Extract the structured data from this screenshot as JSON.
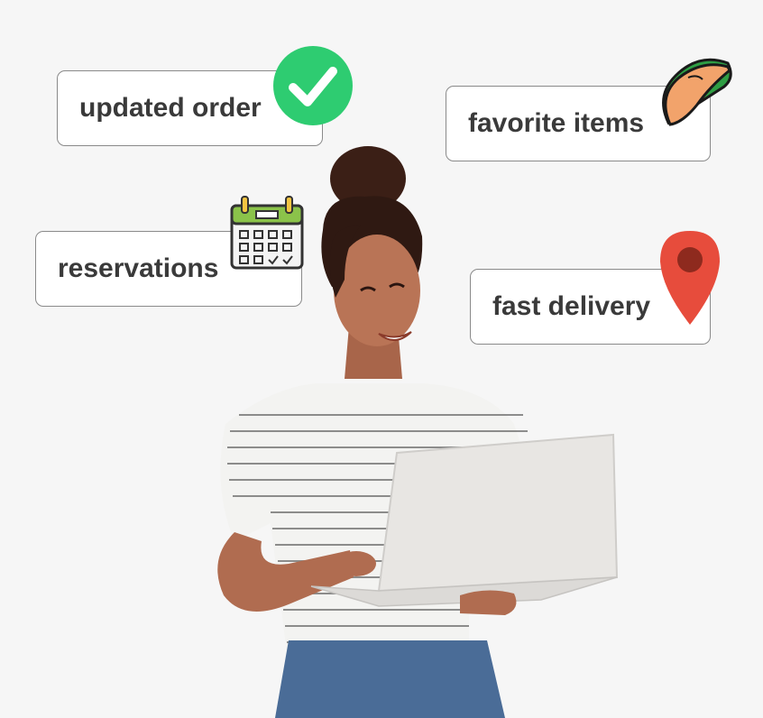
{
  "features": {
    "updated_order": {
      "label": "updated order",
      "icon": "checkmark-circle-icon",
      "color": "#2ecc71"
    },
    "favorite_items": {
      "label": "favorite items",
      "icon": "taco-icon",
      "color": "#f2a36b"
    },
    "reservations": {
      "label": "reservations",
      "icon": "calendar-icon",
      "color": "#8bc34a"
    },
    "fast_delivery": {
      "label": "fast delivery",
      "icon": "map-pin-icon",
      "color": "#e74c3c"
    }
  }
}
